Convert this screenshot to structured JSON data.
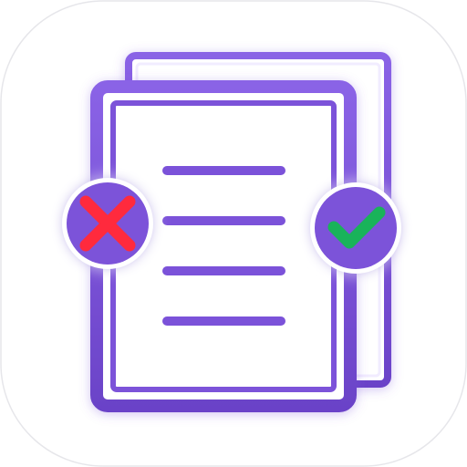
{
  "app_icon": {
    "name": "document-review-app-icon",
    "colors": {
      "tile_background": "#ffffff",
      "tile_border": "#e6e6ea",
      "document_outline": "#7b52d9",
      "document_fill": "#ffffff",
      "document_lines": "#7b52d9",
      "badge_fill": "#7b52d9",
      "reject_mark": "#ff2a3d",
      "approve_mark": "#19b35a"
    },
    "elements": {
      "back_page": "back-document-page",
      "front_page": "front-document-page",
      "text_lines_count": 4,
      "reject_badge": "reject-x-icon",
      "approve_badge": "approve-check-icon"
    }
  }
}
